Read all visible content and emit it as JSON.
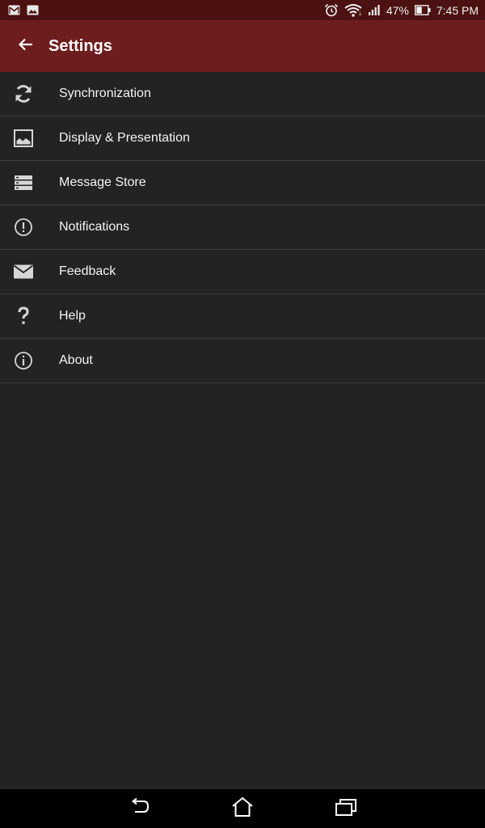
{
  "status_bar": {
    "left_icons": [
      "gmail-icon",
      "gallery-icon"
    ],
    "right_icons": [
      "alarm-icon",
      "wifi-icon",
      "signal-icon",
      "battery-icon"
    ],
    "battery_percent": "47%",
    "time": "7:45 PM"
  },
  "app_bar": {
    "back_icon": "arrow-left-icon",
    "title": "Settings"
  },
  "settings": {
    "items": [
      {
        "label": "Synchronization",
        "icon": "sync-icon"
      },
      {
        "label": "Display & Presentation",
        "icon": "image-icon"
      },
      {
        "label": "Message Store",
        "icon": "storage-icon"
      },
      {
        "label": "Notifications",
        "icon": "alert-circle-icon"
      },
      {
        "label": "Feedback",
        "icon": "mail-icon"
      },
      {
        "label": "Help",
        "icon": "question-icon"
      },
      {
        "label": "About",
        "icon": "info-icon"
      }
    ]
  },
  "nav_bar": {
    "buttons": [
      "back-nav-icon",
      "home-nav-icon",
      "recents-nav-icon"
    ]
  },
  "colors": {
    "status_bar": "#4c1111",
    "app_bar": "#6e1d1f",
    "background": "#232323",
    "divider": "#3e3e3e",
    "nav_bar": "#000000"
  }
}
